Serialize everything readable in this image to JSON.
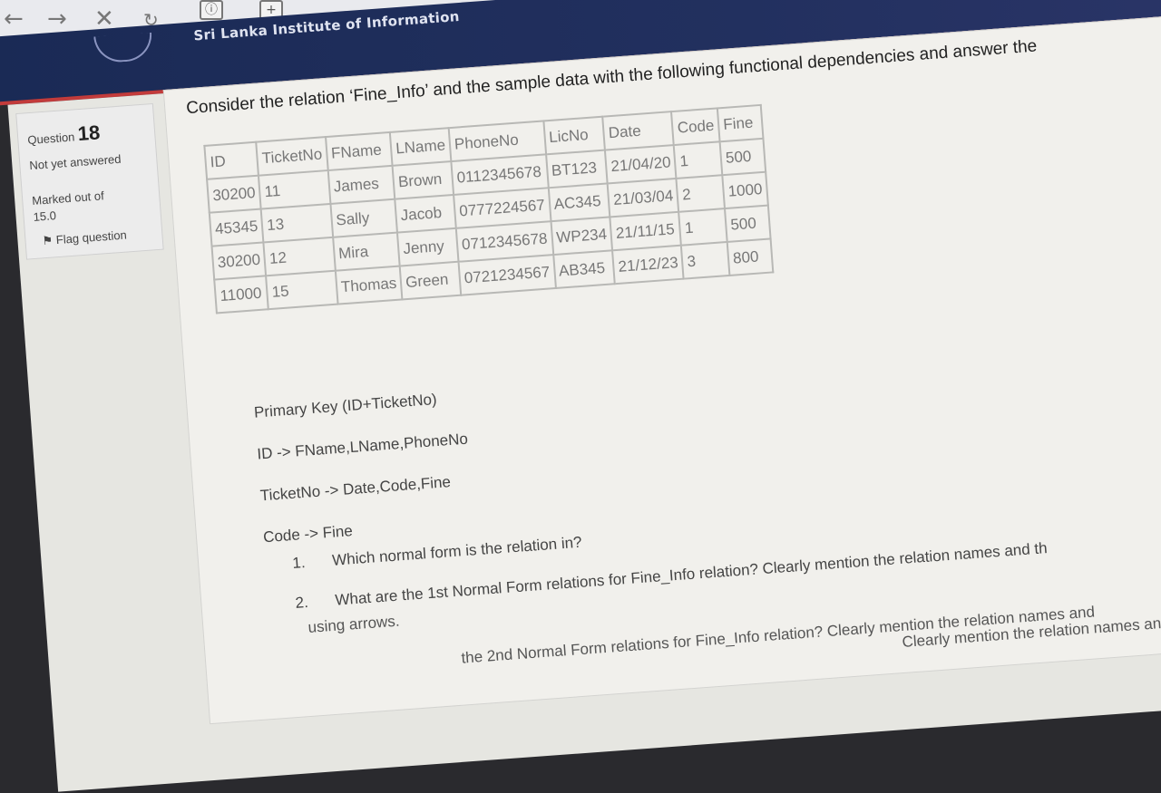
{
  "site": {
    "title": "Sri Lanka Institute of Information"
  },
  "question": {
    "label": "Question",
    "number": "18",
    "status": "Not yet answered",
    "marked_label": "Marked out of",
    "marked_value": "15.0",
    "flag_label": "Flag question",
    "title": "Consider the relation ‘Fine_Info’ and the sample data with the following functional dependencies and answer the"
  },
  "table": {
    "headers": [
      "ID",
      "TicketNo",
      "FName",
      "LName",
      "PhoneNo",
      "LicNo",
      "Date",
      "Code",
      "Fine"
    ],
    "rows": [
      [
        "30200",
        "11",
        "James",
        "Brown",
        "0112345678",
        "BT123",
        "21/04/20",
        "1",
        "500"
      ],
      [
        "45345",
        "13",
        "Sally",
        "Jacob",
        "0777224567",
        "AC345",
        "21/03/04",
        "2",
        "1000"
      ],
      [
        "30200",
        "12",
        "Mira",
        "Jenny",
        "0712345678",
        "WP234",
        "21/11/15",
        "1",
        "500"
      ],
      [
        "11000",
        "15",
        "Thomas",
        "Green",
        "0721234567",
        "AB345",
        "21/12/23",
        "3",
        "800"
      ]
    ]
  },
  "dependencies": [
    "Primary Key (ID+TicketNo)",
    "ID -> FName,LName,PhoneNo",
    "TicketNo -> Date,Code,Fine",
    "Code -> Fine"
  ],
  "tasks": [
    {
      "num": "1.",
      "text": "Which normal form is the relation in?"
    },
    {
      "num": "2.",
      "text": "What are the 1st Normal Form relations for Fine_Info relation? Clearly mention the relation names and th"
    }
  ],
  "fragments": {
    "arrows": "using arrows.",
    "second_nf": "the 2nd Normal Form relations for Fine_Info relation? Clearly mention the relation names and",
    "third": "Clearly mention the relation names and"
  }
}
